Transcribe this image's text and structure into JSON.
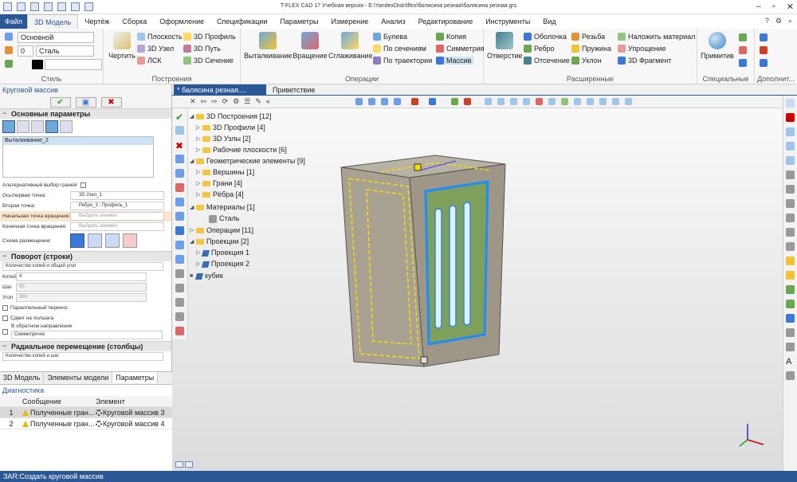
{
  "app": {
    "title": "T-FLEX CAD 17 Учебная версия - E:\\YandexDisk\\tflex\\балясина резная\\балясина резная.grs"
  },
  "menu": {
    "file": "Файл",
    "items": [
      "3D Модель",
      "Чертёж",
      "Сборка",
      "Оформление",
      "Спецификации",
      "Параметры",
      "Измерение",
      "Анализ",
      "Редактирование",
      "Инструменты",
      "Вид"
    ]
  },
  "ribbon": {
    "style": {
      "caption": "Стиль",
      "layer": "Основной",
      "number": "0",
      "material": "Сталь"
    },
    "construction": {
      "caption": "Построения",
      "draw": "Чертить",
      "plane": "Плоскость",
      "node3d": "3D Узел",
      "lsk": "ЛСК",
      "profile3d": "3D Профиль",
      "path3d": "3D Путь",
      "section3d": "3D Сечение"
    },
    "operations": {
      "caption": "Операции",
      "extrude": "Выталкивание",
      "rotate": "Вращение",
      "smooth": "Сглаживание",
      "boolean": "Булева",
      "by_sections": "По сечениям",
      "by_path": "По траектории",
      "copy": "Копия",
      "symmetry": "Симметрия",
      "array": "Массив"
    },
    "extended": {
      "caption": "Расширенные",
      "hole": "Отверстие",
      "shell": "Оболочка",
      "rib": "Ребро",
      "cut": "Отсечение",
      "thread": "Резьба",
      "spring": "Пружина",
      "slope": "Уклон",
      "apply_material": "Наложить материал",
      "simplify": "Упрощение",
      "fragment3d": "3D Фрагмент"
    },
    "special": {
      "caption": "Специальные",
      "primitives": "Примитив"
    },
    "additional": {
      "caption": "Дополнит..."
    }
  },
  "left_panel": {
    "title": "Круговой массив",
    "main_params": "Основные параметры",
    "selected_item": "Выталкивание_2",
    "alt_face_choice": "Альтернативный выбор граней:",
    "axis_point_label": "Ось/первая точка:",
    "axis_point_value": "3D Узел_1",
    "second_point_label": "Вторая точка:",
    "second_point_value": "Ребро_3 : Профиль_1",
    "start_rot_label": "Начальная точка вращения:",
    "start_rot_placeholder": "Выбрать элемент",
    "end_rot_label": "Конечная точка вращения:",
    "end_rot_placeholder": "Выбрать элемент",
    "layout_scheme": "Схема размещения:",
    "rotation_section": "Поворот (строки)",
    "rotation_mode": "Количество копий и общий угол",
    "copies_label": "Копий",
    "copies_value": "4",
    "step_label": "Шаг",
    "step_value": "90",
    "angle_label": "Угол",
    "angle_value": "360",
    "parallel_transfer": "Параллельный перенос",
    "shift_along_path": "Сдвиг на полшага",
    "reverse_direction": "В обратном направлении",
    "symmetric": "Симметрично",
    "radial_section": "Радиальное перемещение (столбцы)",
    "radial_mode": "Количество копий и шаг",
    "tabs": [
      "3D Модель",
      "Элементы модели",
      "Параметры"
    ]
  },
  "diagnostics": {
    "title": "Диагностика",
    "headers": [
      "",
      "Сообщение",
      "Элемент"
    ],
    "rows": [
      {
        "num": "1",
        "message": "Полученные гран...",
        "element": "Круговой массив 3"
      },
      {
        "num": "2",
        "message": "Полученные гран...",
        "element": "Круговой массив 4"
      }
    ]
  },
  "doc_tabs": {
    "active": "* балясина резная....",
    "welcome": "Приветствие"
  },
  "tree": {
    "items": [
      {
        "label": "3D Построения [12]"
      },
      {
        "label": "3D Профили [4]"
      },
      {
        "label": "3D Узлы [2]"
      },
      {
        "label": "Рабочие плоскости [6]"
      },
      {
        "label": "Геометрические элементы [9]"
      },
      {
        "label": "Вершины [1]"
      },
      {
        "label": "Грани [4]"
      },
      {
        "label": "Рёбра [4]"
      },
      {
        "label": "Материалы [1]"
      },
      {
        "label": "Сталь"
      },
      {
        "label": "Операции [11]"
      },
      {
        "label": "Проекции [2]"
      },
      {
        "label": "Проекция 1"
      },
      {
        "label": "Проекция 2"
      },
      {
        "label": "кубик"
      }
    ]
  },
  "status": {
    "text": "ЗАR:Создать круговой массив"
  },
  "colors": {
    "accent": "#2b5797",
    "selection_yellow": "#f2e000",
    "selection_blue": "#1a8cff",
    "body_gray": "#a9a293",
    "face_green": "#7fa05a"
  }
}
